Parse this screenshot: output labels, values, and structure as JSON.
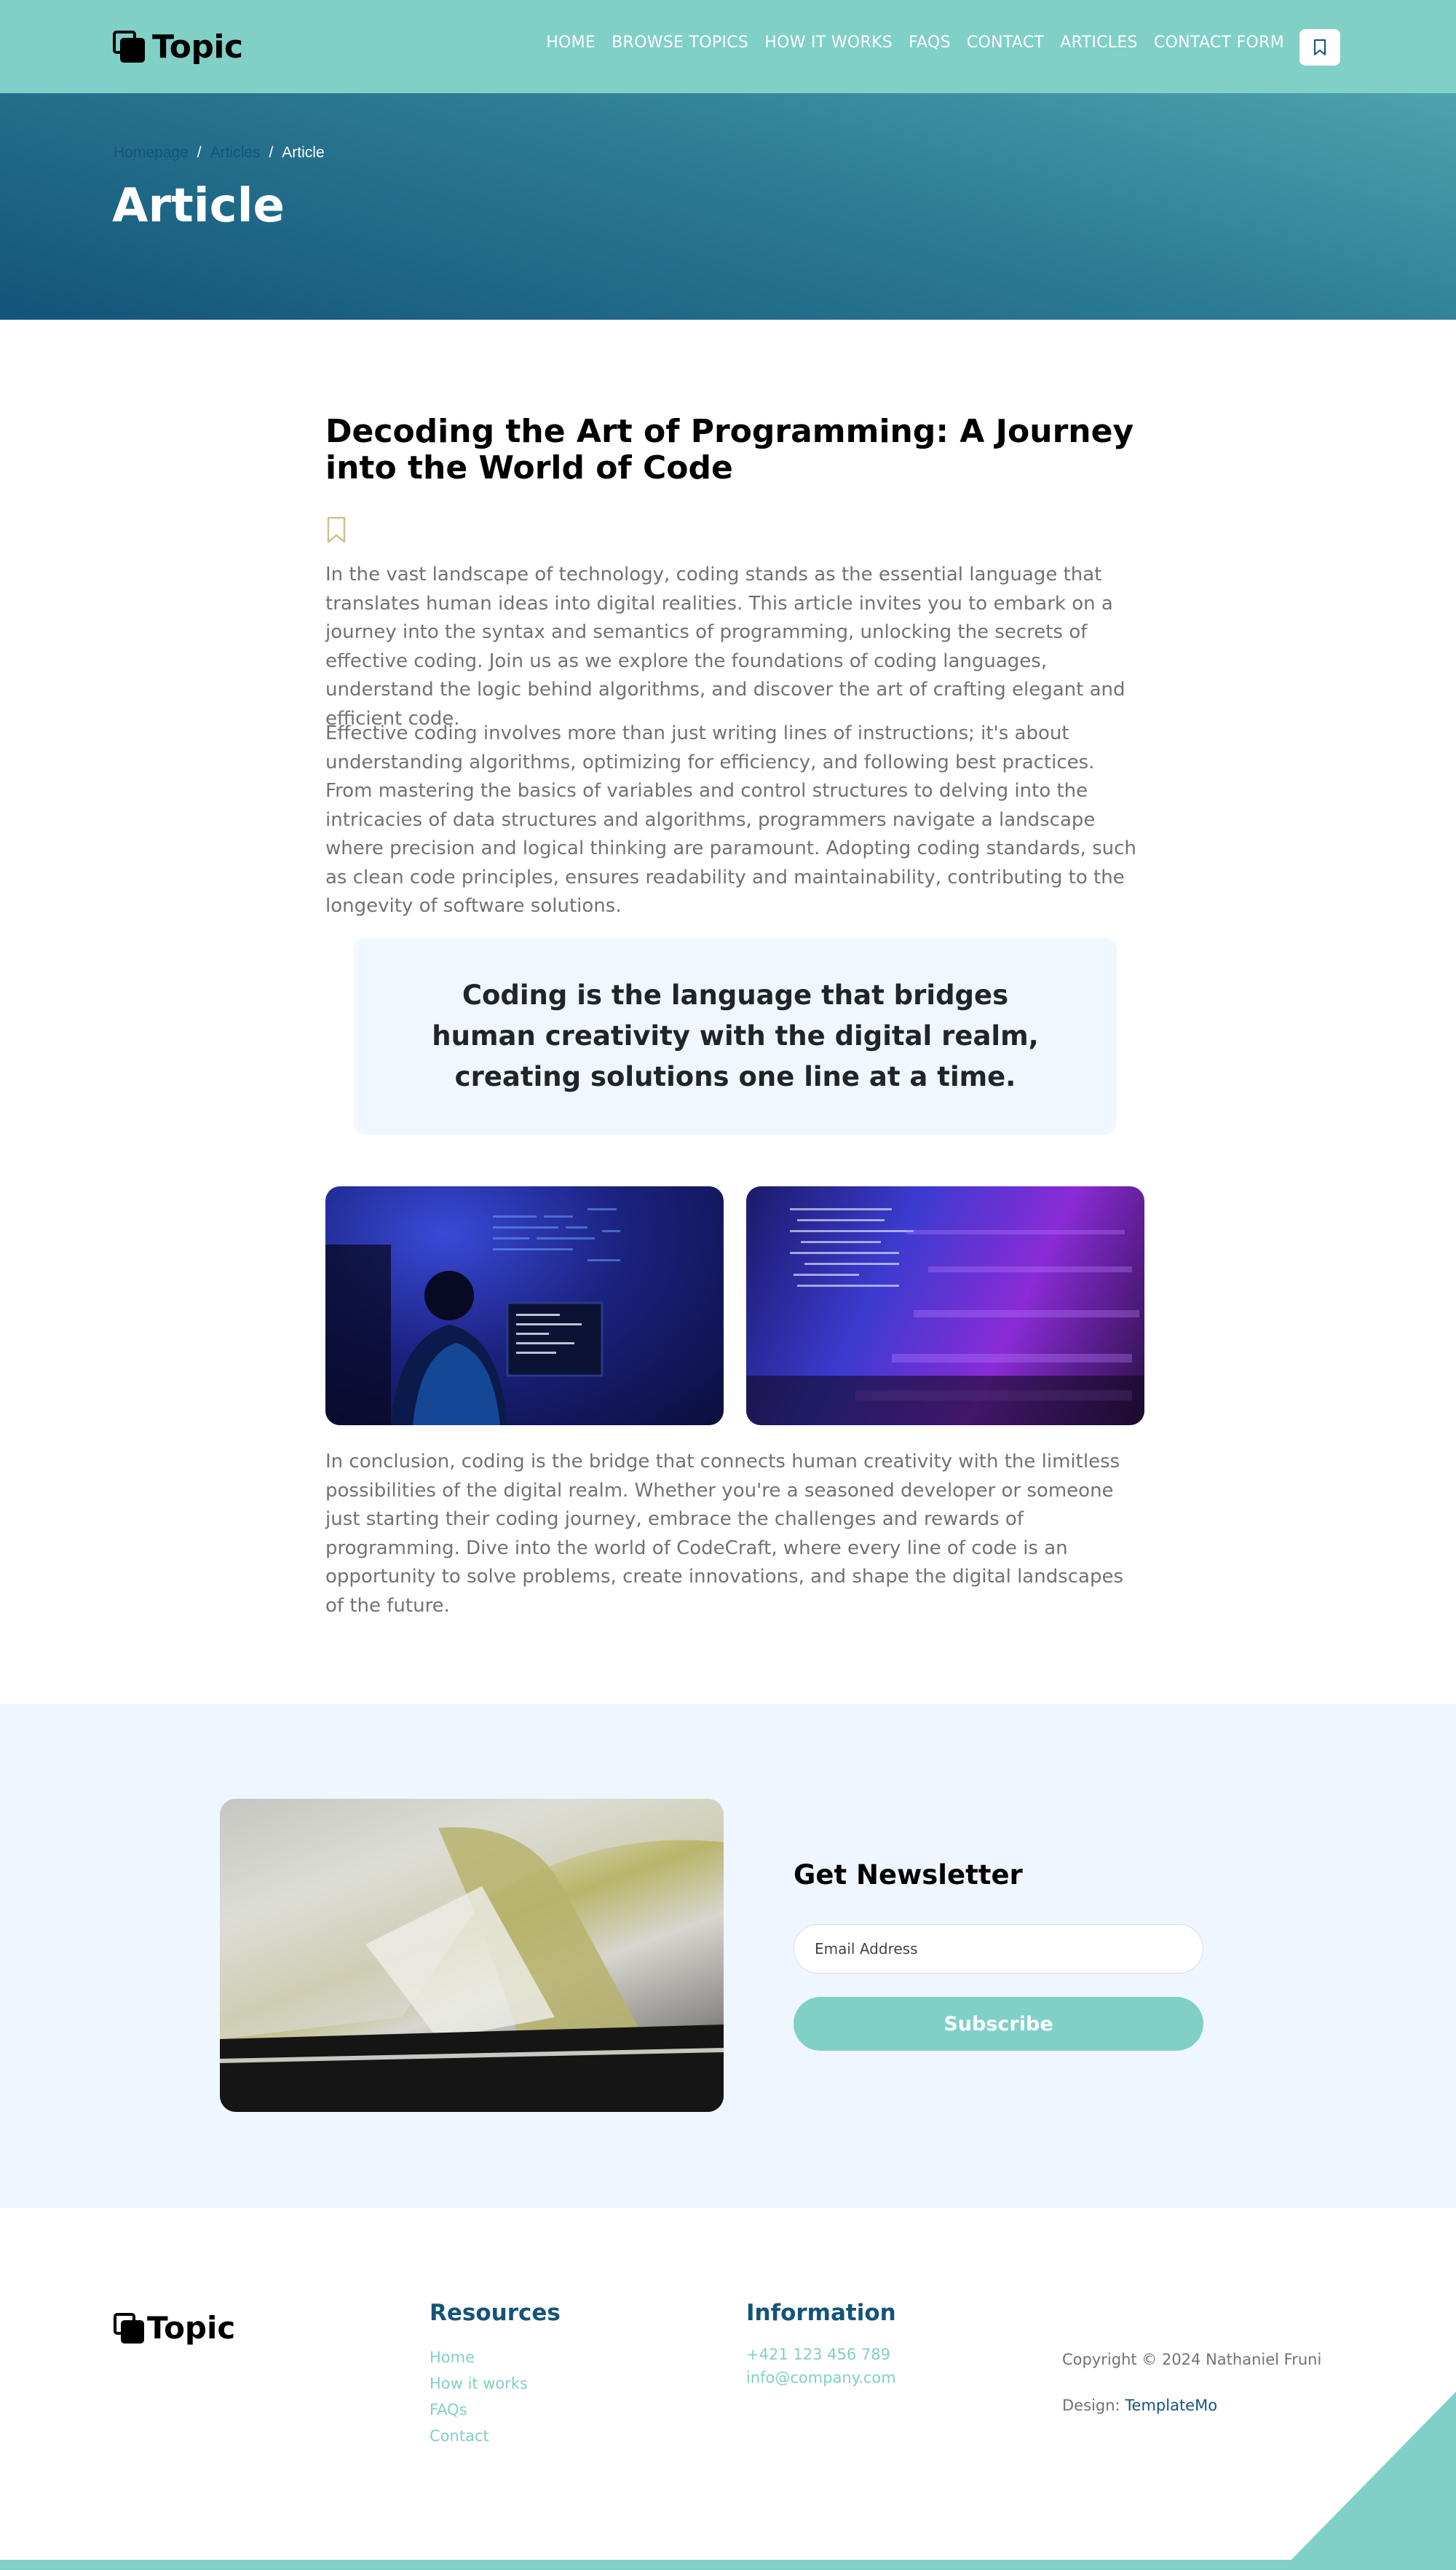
{
  "colors": {
    "primary": "#80d0c7",
    "secondary": "#13547a",
    "section_bg": "#f0f6ff",
    "text": "#717275"
  },
  "header": {
    "brand": "Topic",
    "nav": [
      "HOME",
      "BROWSE TOPICS",
      "HOW IT WORKS",
      "FAQS",
      "CONTACT",
      "ARTICLES",
      "CONTACT FORM"
    ],
    "bookmark_icon": "bookmark-icon"
  },
  "hero": {
    "breadcrumb": [
      "Homepage",
      "Articles",
      "Article"
    ],
    "title": "Article"
  },
  "article": {
    "title": "Decoding the Art of Programming: A Journey into the World of Code",
    "paragraph1": "In the vast landscape of technology, coding stands as the essential language that translates human ideas into digital realities. This article invites you to embark on a journey into the syntax and semantics of programming, unlocking the secrets of effective coding. Join us as we explore the foundations of coding languages, understand the logic behind algorithms, and discover the art of crafting elegant and efficient code.",
    "paragraph2": "Effective coding involves more than just writing lines of instructions; it's about understanding algorithms, optimizing for efficiency, and following best practices. From mastering the basics of variables and control structures to delving into the intricacies of data structures and algorithms, programmers navigate a landscape where precision and logical thinking are paramount. Adopting coding standards, such as clean code principles, ensures readability and maintainability, contributing to the longevity of software solutions.",
    "quote": "Coding is the language that bridges human creativity with the digital realm, creating solutions one line at a time.",
    "paragraph3": "In conclusion, coding is the bridge that connects human creativity with the limitless possibilities of the digital realm. Whether you're a seasoned developer or someone just starting their coding journey, embrace the challenges and rewards of programming. Dive into the world of CodeCraft, where every line of code is an opportunity to solve problems, create innovations, and shape the digital landscapes of the future."
  },
  "newsletter": {
    "title": "Get Newsletter",
    "email_placeholder": "Email Address",
    "subscribe_label": "Subscribe"
  },
  "footer": {
    "brand": "Topic",
    "resources_title": "Resources",
    "resources": [
      "Home",
      "How it works",
      "FAQs",
      "Contact"
    ],
    "information_title": "Information",
    "phone": "+421 123 456 789",
    "email": "info@company.com",
    "copyright": "Copyright © 2024 Nathaniel Fruni",
    "design_label": "Design:",
    "design_link": "TemplateMo"
  }
}
